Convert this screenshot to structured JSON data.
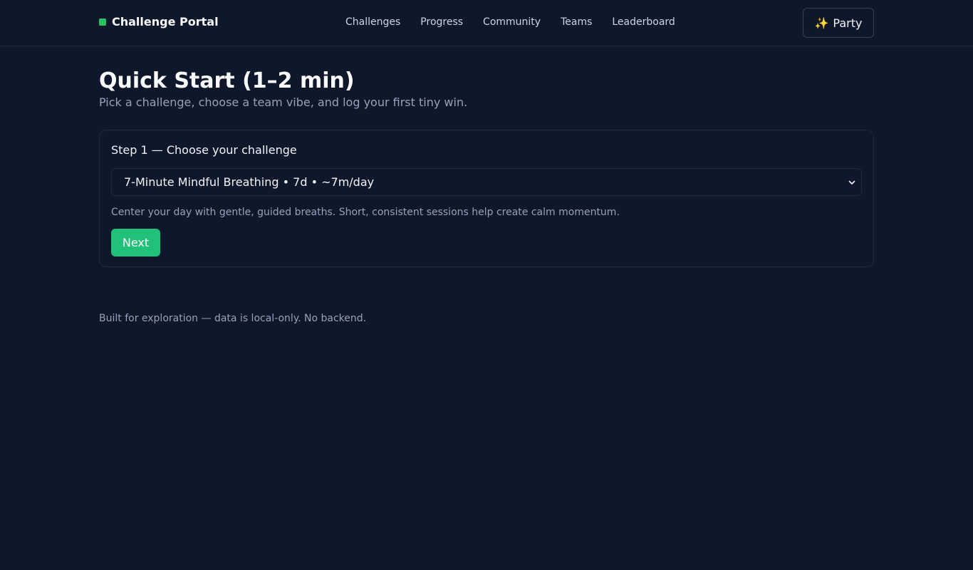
{
  "brand": {
    "name": "Challenge Portal",
    "accent": "#22c55e"
  },
  "nav": {
    "items": [
      "Challenges",
      "Progress",
      "Community",
      "Teams",
      "Leaderboard"
    ]
  },
  "party_button": {
    "icon": "sparkles-icon",
    "icon_glyph": "✨",
    "label": "Party"
  },
  "page": {
    "title": "Quick Start (1–2 min)",
    "subtitle": "Pick a challenge, choose a team vibe, and log your first tiny win."
  },
  "step1": {
    "label": "Step 1 — Choose your challenge",
    "selected_option": "7-Minute Mindful Breathing • 7d • ~7m/day",
    "description": "Center your day with gentle, guided breaths. Short, consistent sessions help create calm momentum.",
    "next_label": "Next"
  },
  "footer": {
    "text": "Built for exploration — data is local-only. No backend."
  }
}
